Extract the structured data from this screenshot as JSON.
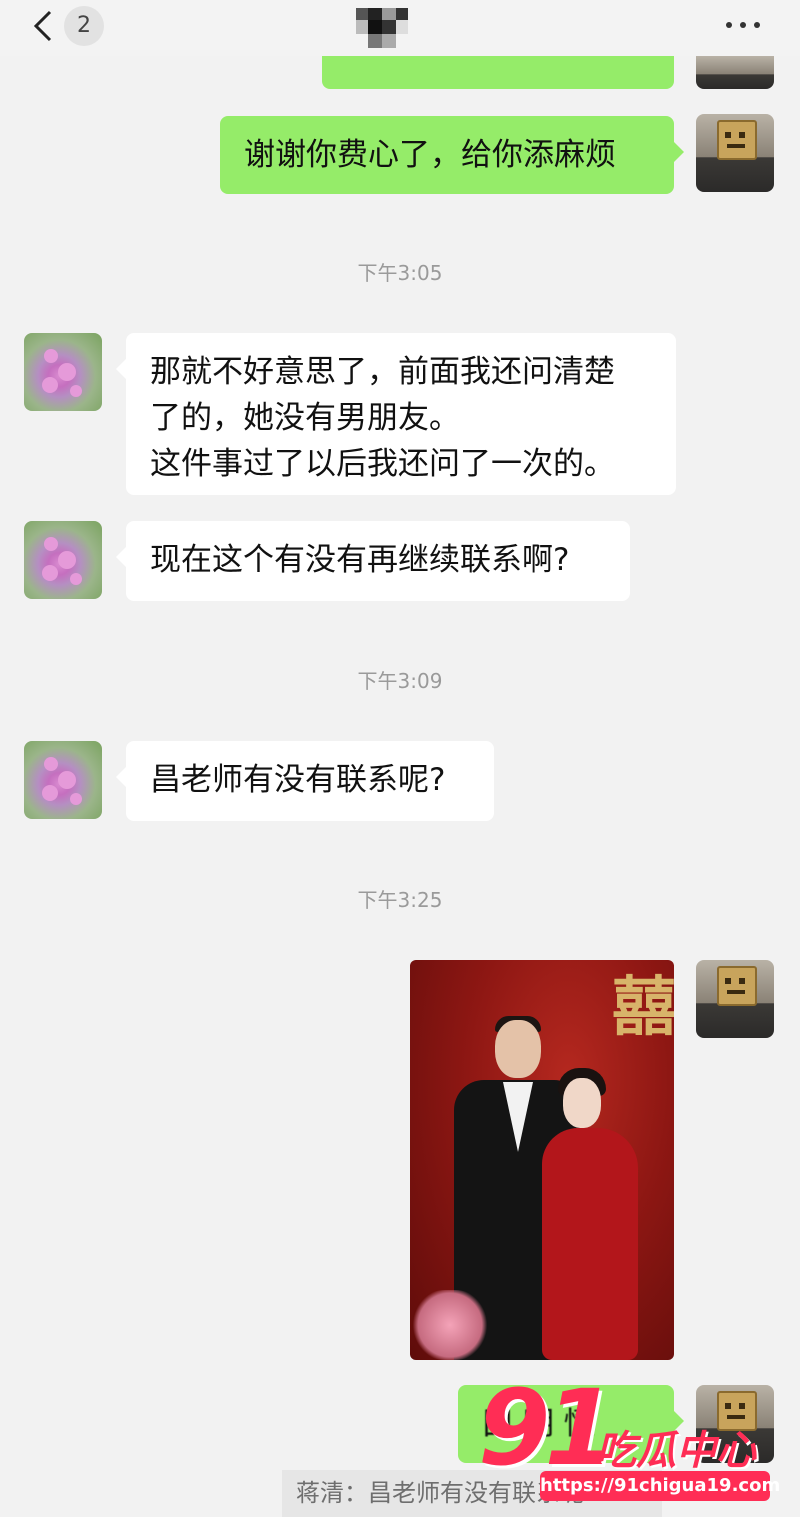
{
  "header": {
    "unread_count": "2",
    "back_icon": "chevron-left-icon",
    "more_icon": "more-dots-icon"
  },
  "messages": {
    "top_out": "谢谢你费心了，给你添麻烦",
    "ts1": "下午3:05",
    "in1": "那就不好意思了，前面我还问清楚\n了的，她没有男朋友。\n这件事过了以后我还问了一次的。",
    "in2": "现在这个有没有再继续联系啊?",
    "ts2": "下午3:09",
    "in3": "昌老师有没有联系呢?",
    "ts3": "下午3:25",
    "photo_sign": "囍",
    "last_out": "囗 明    懂",
    "quote": "蒋清：昌老师有没有联系呢?"
  },
  "watermark": {
    "number": "91",
    "text": "吃瓜中心",
    "url": "https://91chigua19.com"
  },
  "colors": {
    "outgoing_bubble": "#95ec69",
    "incoming_bubble": "#ffffff",
    "background": "#f2f2f2",
    "watermark": "#ff2d55"
  }
}
